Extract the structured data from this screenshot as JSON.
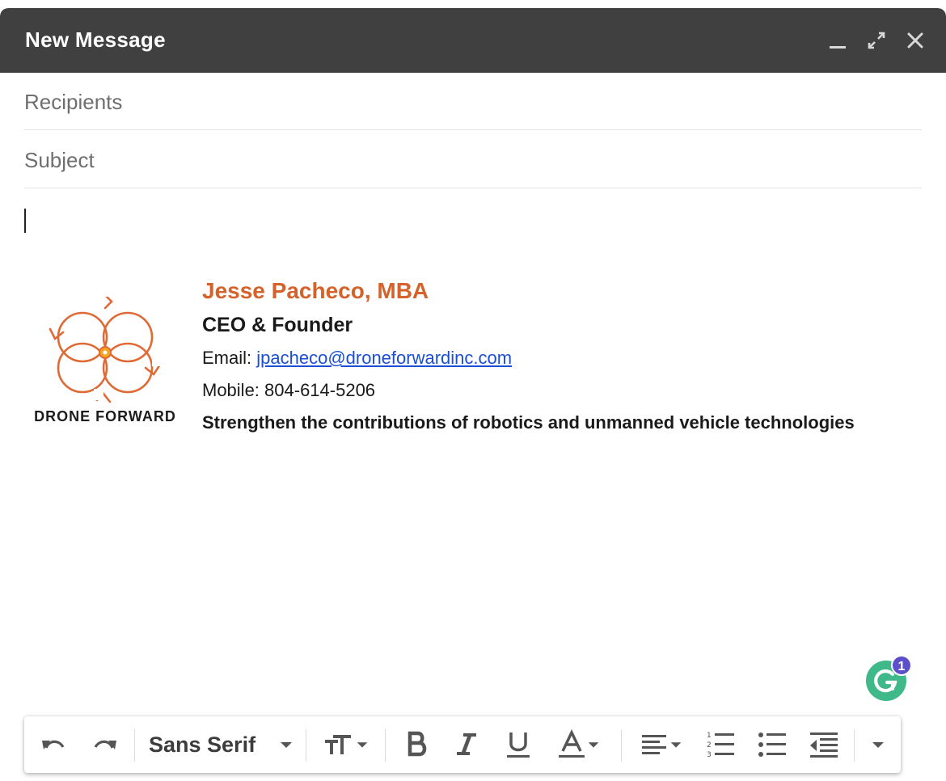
{
  "window": {
    "title": "New Message"
  },
  "fields": {
    "recipients_placeholder": "Recipients",
    "subject_placeholder": "Subject"
  },
  "signature": {
    "logo_text": "DRONE FORWARD",
    "name": "Jesse Pacheco, MBA",
    "role": "CEO & Founder",
    "email_label": "Email: ",
    "email": "jpacheco@droneforwardinc.com",
    "mobile": "Mobile: 804-614-5206",
    "tagline": "Strengthen the contributions of robotics and unmanned vehicle technologies"
  },
  "grammarly": {
    "badge_count": "1"
  },
  "toolbar": {
    "font_family": "Sans Serif"
  },
  "colors": {
    "titlebar": "#404040",
    "accent_orange": "#d4622a",
    "link_blue": "#1a4ed6",
    "grammarly_green": "#3fb88a",
    "badge_purple": "#5b4fcc"
  }
}
